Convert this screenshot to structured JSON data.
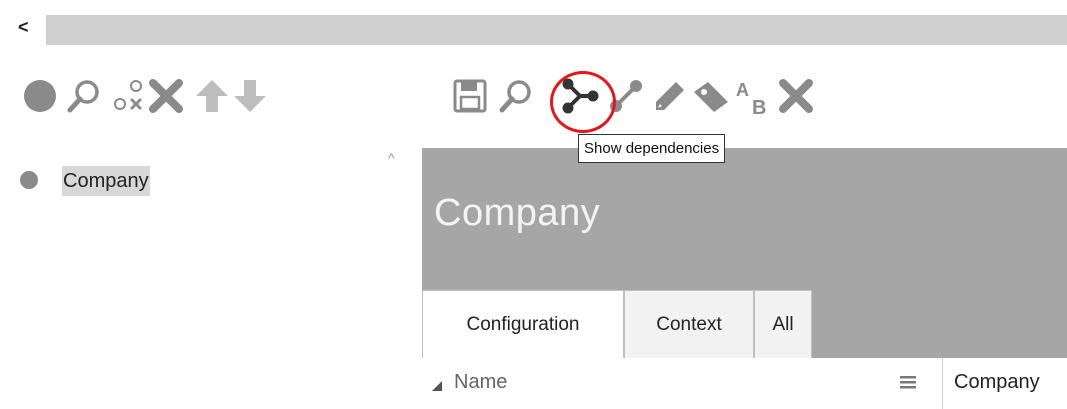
{
  "top_bar": {
    "collapse_glyph": "<"
  },
  "left_toolbar": {
    "items": [
      {
        "icon": "circle-icon"
      },
      {
        "icon": "search-icon"
      },
      {
        "icon": "circle-x-icon"
      },
      {
        "icon": "delete-icon"
      },
      {
        "icon": "arrow-up-icon"
      },
      {
        "icon": "arrow-down-icon"
      }
    ]
  },
  "right_toolbar": {
    "items": [
      {
        "icon": "save-icon"
      },
      {
        "icon": "search-icon"
      },
      {
        "icon": "show-dependencies-icon",
        "tooltip": "Show dependencies",
        "highlighted": true
      },
      {
        "icon": "link-icon"
      },
      {
        "icon": "pencil-icon"
      },
      {
        "icon": "tag-icon"
      },
      {
        "icon": "rename-icon",
        "label_a": "A",
        "label_b": "B"
      },
      {
        "icon": "delete-icon"
      }
    ]
  },
  "tooltip": {
    "text": "Show dependencies"
  },
  "tree": {
    "items": [
      {
        "label": "Company"
      }
    ]
  },
  "detail": {
    "title": "Company",
    "tabs": [
      {
        "label": "Configuration",
        "active": true
      },
      {
        "label": "Context",
        "active": false
      },
      {
        "label": "All",
        "active": false
      }
    ],
    "table": {
      "column_name": "Name",
      "value": "Company"
    }
  },
  "colors": {
    "icon_gray": "#8a8a8a",
    "header_gray": "#a6a6a6",
    "highlight": "#e8141b",
    "selection": "#d8d8d8"
  }
}
